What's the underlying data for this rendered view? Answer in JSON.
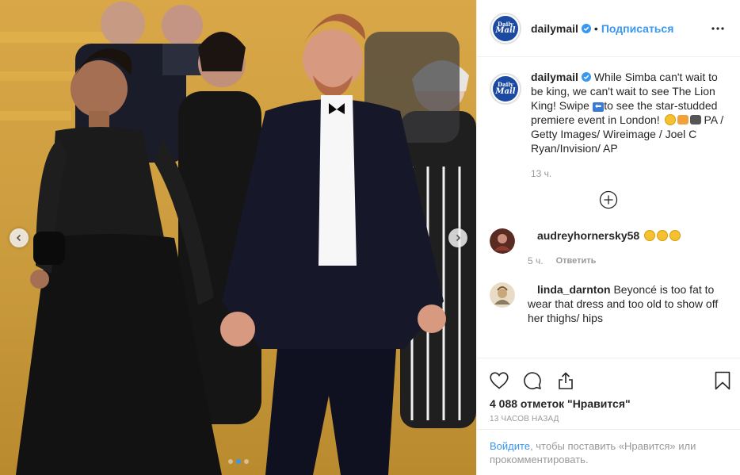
{
  "account": {
    "username": "dailymail",
    "avatar_line1": "Daily",
    "avatar_line2": "Mail",
    "follow_label": "Подписаться",
    "separator": "•"
  },
  "caption": {
    "username": "dailymail",
    "text_part1": "While Simba can't wait to be king, we can't wait to see The Lion King! Swipe ",
    "arrow_emoji": "⬅",
    "text_part2": "to see the star-studded premiere event in London! ",
    "credits": " PA / Getty Images/ Wireimage / Joel C Ryan/Invision/ AP",
    "time": "13 ч."
  },
  "comments": [
    {
      "username": "audreyhornersky58",
      "text": "",
      "time": "5 ч.",
      "reply_label": "Ответить"
    },
    {
      "username": "linda_darnton",
      "text": "Beyoncé is too fat to wear that dress and too old to show off her thighs/ hips"
    }
  ],
  "likes_text": "4 088 отметок \"Нравится\"",
  "timestamp": "13 ЧАСОВ НАЗАД",
  "login_prompt": {
    "link": "Войдите",
    "text": ", чтобы поставить «Нравится» или прокомментировать."
  },
  "carousel": {
    "active_index": 1,
    "count": 3
  },
  "colors": {
    "accent": "#3897f0",
    "dailymail_blue": "#1c4aa3",
    "carpet": "#c99a3c"
  },
  "icons": [
    "chevron-left-icon",
    "chevron-right-icon",
    "more-icon",
    "verified-icon",
    "plus-circle-icon",
    "heart-icon",
    "comment-icon",
    "share-icon",
    "bookmark-icon"
  ]
}
